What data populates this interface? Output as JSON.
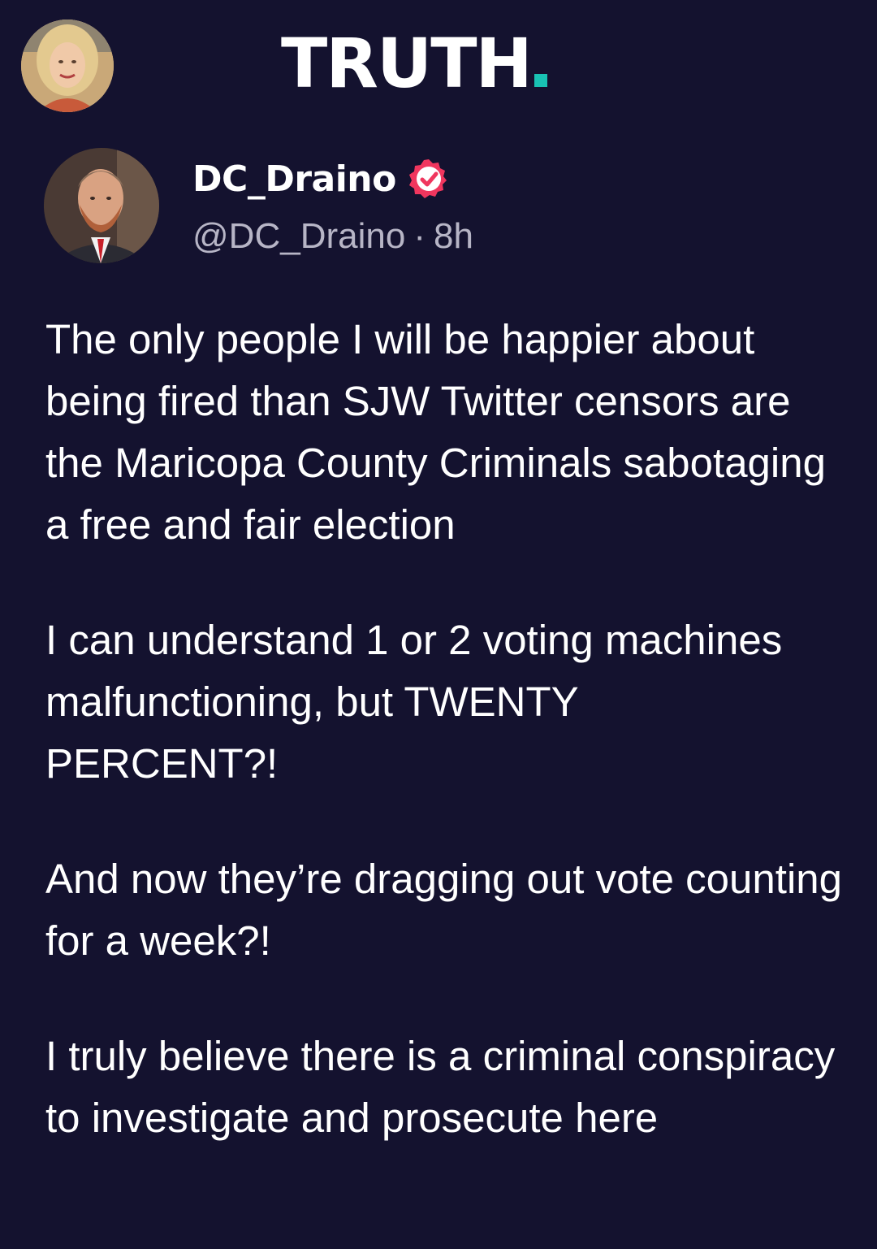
{
  "header": {
    "logo_text": "TRUTH",
    "logo_accent_color": "#19c2b4",
    "current_user_avatar_icon": "user-avatar"
  },
  "post": {
    "author": {
      "display_name": "DC_Draino",
      "verified_icon": "verified-badge-icon",
      "verified_color": "#f0365e",
      "handle": "@DC_Draino",
      "separator": "·",
      "time_ago": "8h"
    },
    "paragraphs": [
      "The only people I will be happier about being fired than SJW Twitter censors are the Maricopa County Criminals sabotaging a free and fair election",
      "I can understand 1 or 2 voting machines malfunctioning, but TWENTY\nPERCENT?!",
      "And now they’re dragging out vote counting for a week?!",
      "I truly believe there is a criminal conspiracy to investigate and prosecute here"
    ]
  },
  "colors": {
    "background": "#14122f",
    "text_primary": "#ffffff",
    "text_secondary": "#b7b5c6"
  }
}
